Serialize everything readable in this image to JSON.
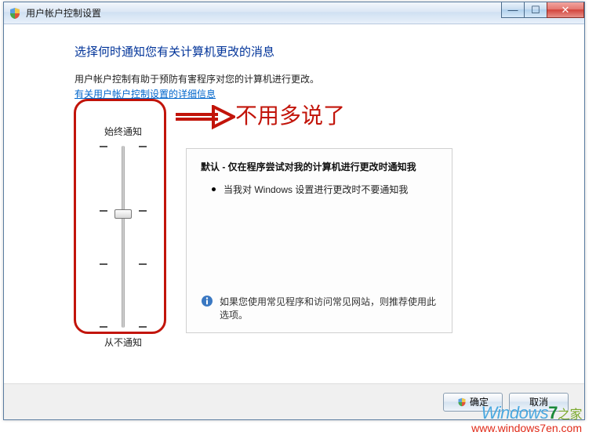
{
  "window": {
    "title": "用户帐户控制设置"
  },
  "main": {
    "heading": "选择何时通知您有关计算机更改的消息",
    "description": "用户帐户控制有助于预防有害程序对您的计算机进行更改。",
    "link": "有关用户帐户控制设置的详细信息"
  },
  "slider": {
    "top_label": "始终通知",
    "bottom_label": "从不通知",
    "levels": 4,
    "current_level": 2
  },
  "panel": {
    "title": "默认 - 仅在程序尝试对我的计算机进行更改时通知我",
    "bullet": "当我对 Windows 设置进行更改时不要通知我",
    "recommend": "如果您使用常见程序和访问常见网站，则推荐使用此选项。"
  },
  "footer": {
    "ok": "确定",
    "cancel": "取消"
  },
  "annotation": {
    "text": "不用多说了"
  },
  "watermark": {
    "brand_prefix": "Windows",
    "brand_seven": "7",
    "brand_suffix": "之家",
    "url": "www.windows7en.com"
  }
}
